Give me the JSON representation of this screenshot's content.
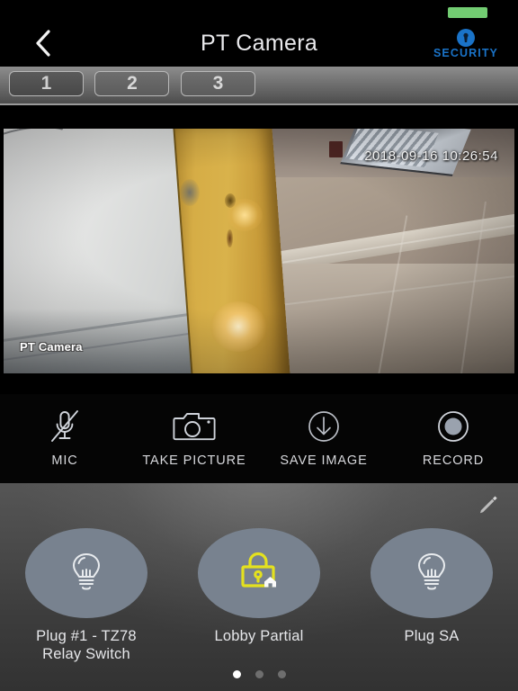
{
  "statusbar": {
    "battery_icon": "battery-green",
    "battery_color": "#72cc72"
  },
  "navbar": {
    "back_icon": "chevron-left-icon",
    "title": "PT Camera",
    "logo_text": "SECURITY",
    "logo_icon": "security-shield-keyhole-icon",
    "logo_color": "#1a73c8"
  },
  "camera_tabs": {
    "items": [
      {
        "label": "1",
        "selected": true
      },
      {
        "label": "2",
        "selected": false
      },
      {
        "label": "3",
        "selected": false
      }
    ]
  },
  "video": {
    "osd_timestamp": "2018-09-16 10:26:54",
    "osd_camera_name": "PT Camera",
    "scene_description": "indoor hallway with wooden post"
  },
  "toolbar": {
    "items": [
      {
        "label": "MIC",
        "icon": "microphone-muted-icon"
      },
      {
        "label": "TAKE PICTURE",
        "icon": "camera-icon"
      },
      {
        "label": "SAVE IMAGE",
        "icon": "download-arrow-circle-icon"
      },
      {
        "label": "RECORD",
        "icon": "record-dot-icon"
      }
    ]
  },
  "devices": {
    "edit_icon": "pencil-edit-icon",
    "tiles": [
      {
        "label": "Plug #1 - TZ78\nRelay Switch",
        "icon": "lightbulb-icon",
        "icon_color": "#e8ebee"
      },
      {
        "label": "Lobby Partial",
        "icon": "lock-home-icon",
        "icon_color": "#e4e11e"
      },
      {
        "label": "Plug SA",
        "icon": "lightbulb-icon",
        "icon_color": "#e8ebee"
      }
    ],
    "page_dots": [
      {
        "active": true
      },
      {
        "active": false
      },
      {
        "active": false
      }
    ]
  }
}
